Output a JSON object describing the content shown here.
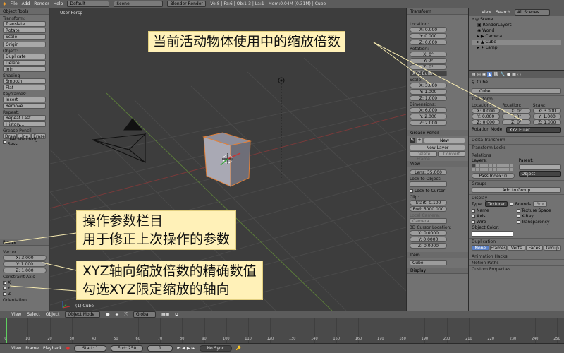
{
  "topbar": {
    "menus": [
      "File",
      "Add",
      "Render",
      "Help"
    ],
    "layout": "Default",
    "scene": "Scene",
    "engine": "Blender Render",
    "stats": "Ve:8 | Fa:6 | Ob:1-3 | La:1 | Mem:0.04M (0.31M) | Cube"
  },
  "toolshelf": {
    "title": "Object Tools",
    "transform_label": "Transform:",
    "translate": "Translate",
    "rotate": "Rotate",
    "scale": "Scale",
    "origin": "Origin",
    "object_label": "Object:",
    "duplicate": "Duplicate",
    "delete": "Delete",
    "join": "Join",
    "shading_label": "Shading",
    "smooth": "Smooth",
    "flat": "Flat",
    "keyframes_label": "Keyframes:",
    "insert": "Insert",
    "remove": "Remove",
    "repeat_label": "Repeat:",
    "repeat_last": "Repeat Last",
    "history": "History...",
    "grease_label": "Grease Pencil:",
    "draw": "Draw",
    "line": "Line",
    "erase": "Erase",
    "use_sketching": "Use Sketching Sessi"
  },
  "redo": {
    "title": "Resize",
    "vector_label": "Vector",
    "x": "X: 3.000",
    "y": "Y: 1.000",
    "z": "Z: 1.000",
    "constraint_label": "Constraint Axis",
    "cx": "X",
    "cy": "Y",
    "cz": "Z",
    "orientation_label": "Orientation"
  },
  "viewport": {
    "label": "User Persp",
    "object_label": "(1) Cube"
  },
  "npanel": {
    "transform_title": "Transform",
    "location_label": "Location:",
    "lx": "X: 0.000",
    "ly": "Y: 0.000",
    "lz": "Z: 0.000",
    "rotation_label": "Rotation:",
    "rx": "X: 0°",
    "ry": "Y: 0°",
    "rz": "Z: 0°",
    "euler": "XYZ Euler",
    "scale_label": "Scale:",
    "sx": "X: 3.000",
    "sy": "Y: 1.000",
    "sz": "Z: 1.000",
    "dimensions_label": "Dimensions:",
    "dx": "X: 6.000",
    "dy": "Y: 2.000",
    "dz": "Z: 2.000",
    "grease_title": "Grease Pencil",
    "new": "New",
    "new_layer": "New Layer",
    "delete_frame": "Delete Frame",
    "convert": "Convert",
    "view_title": "View",
    "lens": "Lens: 35.000",
    "lock_object_label": "Lock to Object:",
    "lock_cursor": "Lock to Cursor",
    "clip_label": "Clip:",
    "clip_start": "Start: 0.100",
    "clip_end": "End: 5000.000",
    "local_camera_label": "Local Camera:",
    "camera": "Camera",
    "cursor_label": "3D Cursor Location:",
    "cx": "X: 0.0000",
    "cy": "Y: 0.0000",
    "cz": "Z: 0.0000",
    "item_title": "Item",
    "item_name": "Cube",
    "display_title": "Display"
  },
  "outliner": {
    "menus": [
      "View",
      "Search"
    ],
    "filter": "All Scenes",
    "items": [
      "Scene",
      "RenderLayers",
      "World",
      "Camera",
      "Cube",
      "Lamp"
    ]
  },
  "props": {
    "breadcrumb": "Cube",
    "name": "Cube",
    "transform_title": "Transform",
    "location_label": "Location:",
    "rotation_label": "Rotation:",
    "scale_label": "Scale:",
    "lx": "X: 0.000",
    "ly": "Y: 0.000",
    "lz": "Z: 0.000",
    "rx": "X: 0°",
    "ry": "Y: 0°",
    "rz": "Z: 0°",
    "sx": "X: 3.000",
    "sy": "Y: 1.000",
    "sz": "Z: 1.000",
    "rotation_mode_label": "Rotation Mode:",
    "rotation_mode": "XYZ Euler",
    "delta": "Delta Transform",
    "locks": "Transform Locks",
    "relations": "Relations",
    "layers_label": "Layers:",
    "parent_label": "Parent:",
    "object": "Object",
    "pass_index": "Pass Index: 0",
    "groups": "Groups",
    "add_group": "Add to Group",
    "display": "Display",
    "type_label": "Type:",
    "type_value": "Textured",
    "bounds": "Bounds",
    "box": "Box",
    "opt_name": "Name",
    "opt_texture": "Texture Space",
    "opt_axis": "Axis",
    "opt_xray": "X-Ray",
    "opt_wire": "Wire",
    "opt_transp": "Transparency",
    "object_color": "Object Color:",
    "duplication": "Duplication",
    "dup_none": "None",
    "dup_frames": "Frames",
    "dup_verts": "Verts",
    "dup_faces": "Faces",
    "dup_group": "Group",
    "anim_hacks": "Animation Hacks",
    "motion_paths": "Motion Paths",
    "custom_props": "Custom Properties"
  },
  "timeline_header": {
    "menus": [
      "View",
      "Select",
      "Object"
    ],
    "mode": "Object Mode",
    "orientation": "Global"
  },
  "timeline": {
    "ticks": [
      "0",
      "10",
      "20",
      "30",
      "40",
      "50",
      "60",
      "70",
      "80",
      "90",
      "100",
      "110",
      "120",
      "130",
      "140",
      "150",
      "160",
      "170",
      "180",
      "190",
      "200",
      "210",
      "220",
      "230",
      "240",
      "250"
    ]
  },
  "bottombar": {
    "menus": [
      "View",
      "Frame",
      "Playback"
    ],
    "start": "Start: 1",
    "end": "End: 250",
    "current": "1",
    "sync": "No Sync"
  },
  "annotations": {
    "scale_note": "当前活动物体使用中的缩放倍数",
    "redo_note_1": "操作参数栏目",
    "redo_note_2": "用于修正上次操作的参数",
    "vector_note_1": "XYZ轴向缩放倍数的精确数值",
    "vector_note_2": "勾选XYZ限定缩放的轴向"
  },
  "colors": {
    "selection_outline": "#e0803a",
    "annotation_bg": "#fff1b8",
    "active_blue": "#5a7fc4"
  }
}
